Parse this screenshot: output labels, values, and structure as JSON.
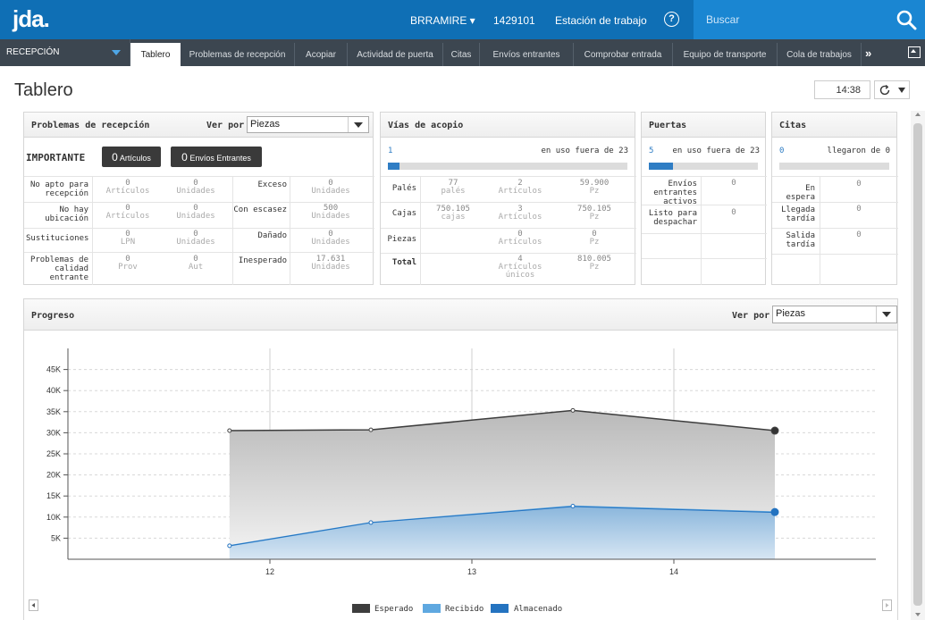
{
  "header": {
    "logo": "jda.",
    "user": "BRRAMIRE ▾",
    "id": "1429101",
    "station": "Estación de trabajo",
    "help": "?",
    "search_placeholder": "Buscar"
  },
  "nav": {
    "module": "RECEPCIÓN",
    "tabs": [
      "Tablero",
      "Problemas de recepción",
      "Acopiar",
      "Actividad de puerta",
      "Citas",
      "Envíos entrantes",
      "Comprobar entrada",
      "Equipo de transporte",
      "Cola de trabajos"
    ],
    "active_tab": "Tablero",
    "more": "»"
  },
  "page": {
    "title": "Tablero",
    "time": "14:38"
  },
  "problemas": {
    "title": "Problemas de recepción",
    "ver_por": "Ver por",
    "select": "Piezas",
    "importante": "IMPORTANTE",
    "btn_articulos_count": "0",
    "btn_articulos_label": "Artículos",
    "btn_envios_count": "0",
    "btn_envios_label": "Envíos Entrantes",
    "rows": [
      {
        "label": "No apto para recepción",
        "v1": "0",
        "u1": "Artículos",
        "v2": "0",
        "u2": "Unidades",
        "label2": "Exceso",
        "v3": "0",
        "u3": "Unidades"
      },
      {
        "label": "No hay ubicación",
        "v1": "0",
        "u1": "Artículos",
        "v2": "0",
        "u2": "Unidades",
        "label2": "Con escasez",
        "v3": "500",
        "u3": "Unidades"
      },
      {
        "label": "Sustituciones",
        "v1": "0",
        "u1": "LPN",
        "v2": "0",
        "u2": "Unidades",
        "label2": "Dañado",
        "v3": "0",
        "u3": "Unidades"
      },
      {
        "label": "Problemas de calidad entrante",
        "v1": "0",
        "u1": "Prov",
        "v2": "0",
        "u2": "Aut",
        "label2": "Inesperado",
        "v3": "17.631",
        "u3": "Unidades"
      }
    ]
  },
  "vias": {
    "title": "Vías de acopio",
    "in_use": "1",
    "of_total": "en uso fuera de 23",
    "progress": 0.05,
    "rows": [
      {
        "label": "Palés",
        "v1": "77",
        "u1": "palés",
        "v2": "2",
        "u2": "Artículos",
        "v3": "59.900",
        "u3": "Pz"
      },
      {
        "label": "Cajas",
        "v1": "750.105",
        "u1": "cajas",
        "v2": "3",
        "u2": "Artículos",
        "v3": "750.105",
        "u3": "Pz"
      },
      {
        "label": "Piezas",
        "v1": "",
        "u1": "",
        "v2": "0",
        "u2": "Artículos",
        "v3": "0",
        "u3": "Pz"
      },
      {
        "label": "Total",
        "v1": "",
        "u1": "",
        "v2": "4",
        "u2": "Artículos únicos",
        "v3": "810.005",
        "u3": "Pz"
      }
    ]
  },
  "puertas": {
    "title": "Puertas",
    "in_use": "5",
    "of_total": "en uso fuera de 23",
    "progress": 0.22,
    "rows": [
      {
        "label": "Envíos entrantes activos",
        "v": "0"
      },
      {
        "label": "Listo para despachar",
        "v": "0"
      }
    ]
  },
  "citas": {
    "title": "Citas",
    "count": "0",
    "of_total": "llegaron de 0",
    "progress": 0,
    "rows": [
      {
        "label": "En espera",
        "v": "0"
      },
      {
        "label": "Llegada tardía",
        "v": "0"
      },
      {
        "label": "Salida tardía",
        "v": "0"
      }
    ]
  },
  "progreso": {
    "title": "Progreso",
    "ver_por": "Ver por",
    "select": "Piezas"
  },
  "colors": {
    "esperado": "#3d3d3d",
    "recibido": "#5fa8e0",
    "almacenado": "#2473c0",
    "brand": "#0f6fb5",
    "important": "#d9231b"
  },
  "chart_data": {
    "type": "area",
    "x": [
      11.8,
      12.5,
      13.5,
      14.5
    ],
    "xlim": [
      11.0,
      15.0
    ],
    "xticks": [
      "12",
      "13",
      "14"
    ],
    "xtick_values": [
      12,
      13,
      14
    ],
    "ylim": [
      0,
      50000
    ],
    "yticks": [
      "5K",
      "10K",
      "15K",
      "20K",
      "25K",
      "30K",
      "35K",
      "40K",
      "45K"
    ],
    "ytick_values": [
      5000,
      10000,
      15000,
      20000,
      25000,
      30000,
      35000,
      40000,
      45000
    ],
    "series": [
      {
        "name": "Esperado",
        "values": [
          30500,
          30700,
          35300,
          30500
        ]
      },
      {
        "name": "Recibido",
        "values": [
          3200,
          8700,
          12600,
          11200
        ]
      },
      {
        "name": "Almacenado",
        "values": [
          3200,
          8700,
          12500,
          11100
        ]
      }
    ],
    "legend": "bottom"
  }
}
